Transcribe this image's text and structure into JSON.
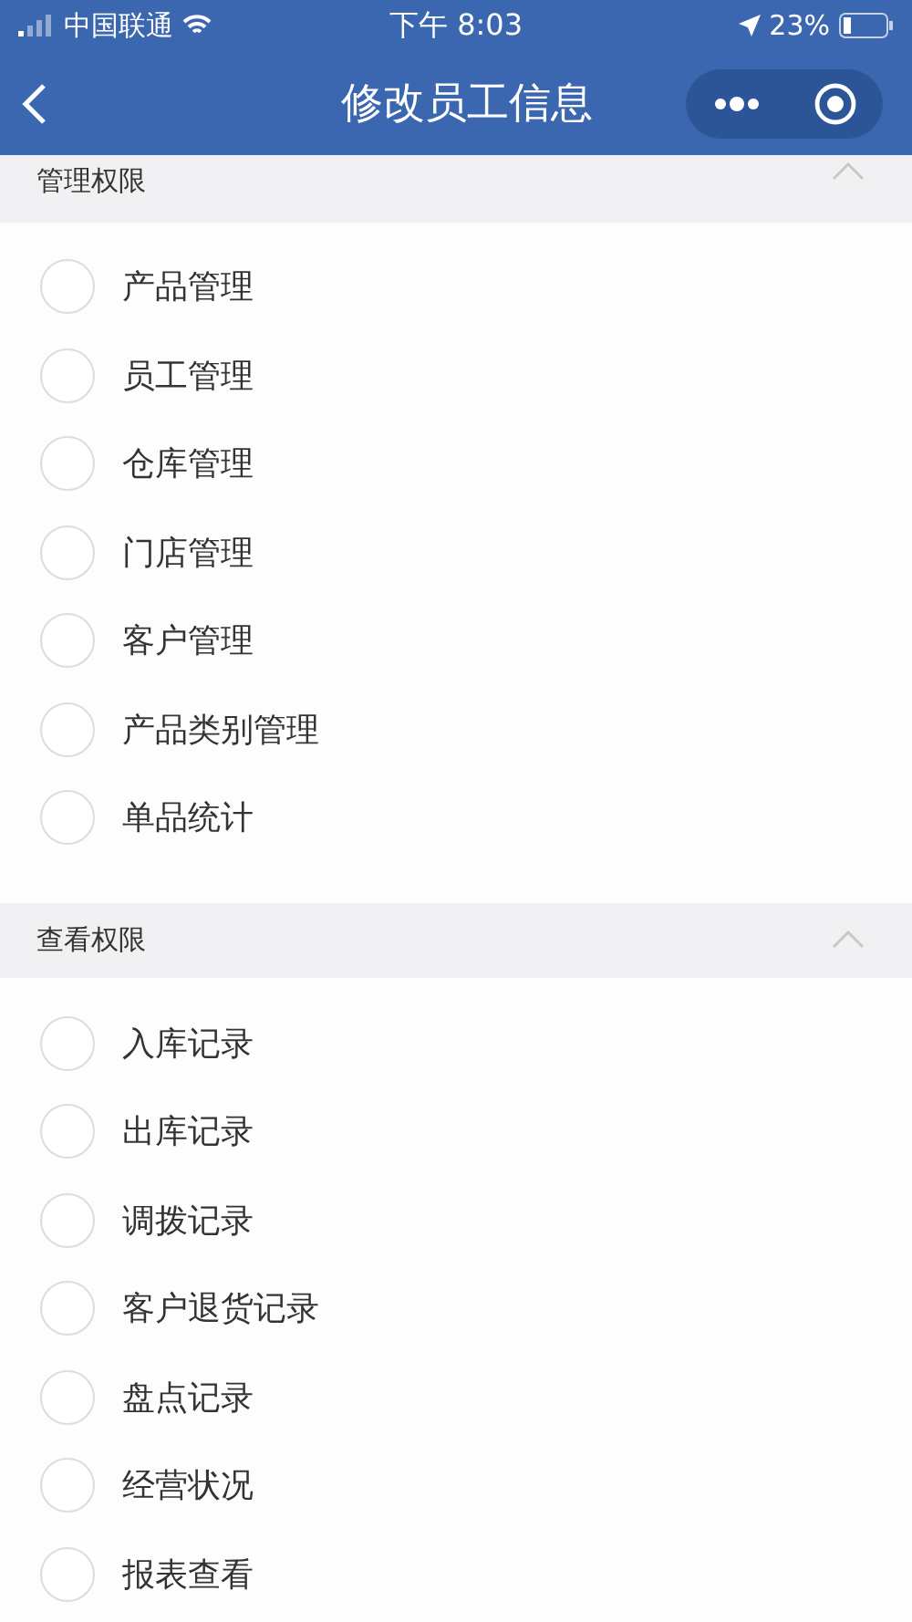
{
  "status_bar": {
    "carrier": "中国联通",
    "time": "下午 8:03",
    "battery": "23%"
  },
  "nav": {
    "title": "修改员工信息"
  },
  "sections": [
    {
      "title": "管理权限",
      "expanded": true,
      "items": [
        {
          "label": "产品管理",
          "checked": false
        },
        {
          "label": "员工管理",
          "checked": false
        },
        {
          "label": "仓库管理",
          "checked": false
        },
        {
          "label": "门店管理",
          "checked": false
        },
        {
          "label": "客户管理",
          "checked": false
        },
        {
          "label": "产品类别管理",
          "checked": false
        },
        {
          "label": "单品统计",
          "checked": false
        }
      ]
    },
    {
      "title": "查看权限",
      "expanded": true,
      "items": [
        {
          "label": "入库记录",
          "checked": false
        },
        {
          "label": "出库记录",
          "checked": false
        },
        {
          "label": "调拨记录",
          "checked": false
        },
        {
          "label": "客户退货记录",
          "checked": false
        },
        {
          "label": "盘点记录",
          "checked": false
        },
        {
          "label": "经营状况",
          "checked": false
        },
        {
          "label": "报表查看",
          "checked": false
        }
      ]
    }
  ]
}
